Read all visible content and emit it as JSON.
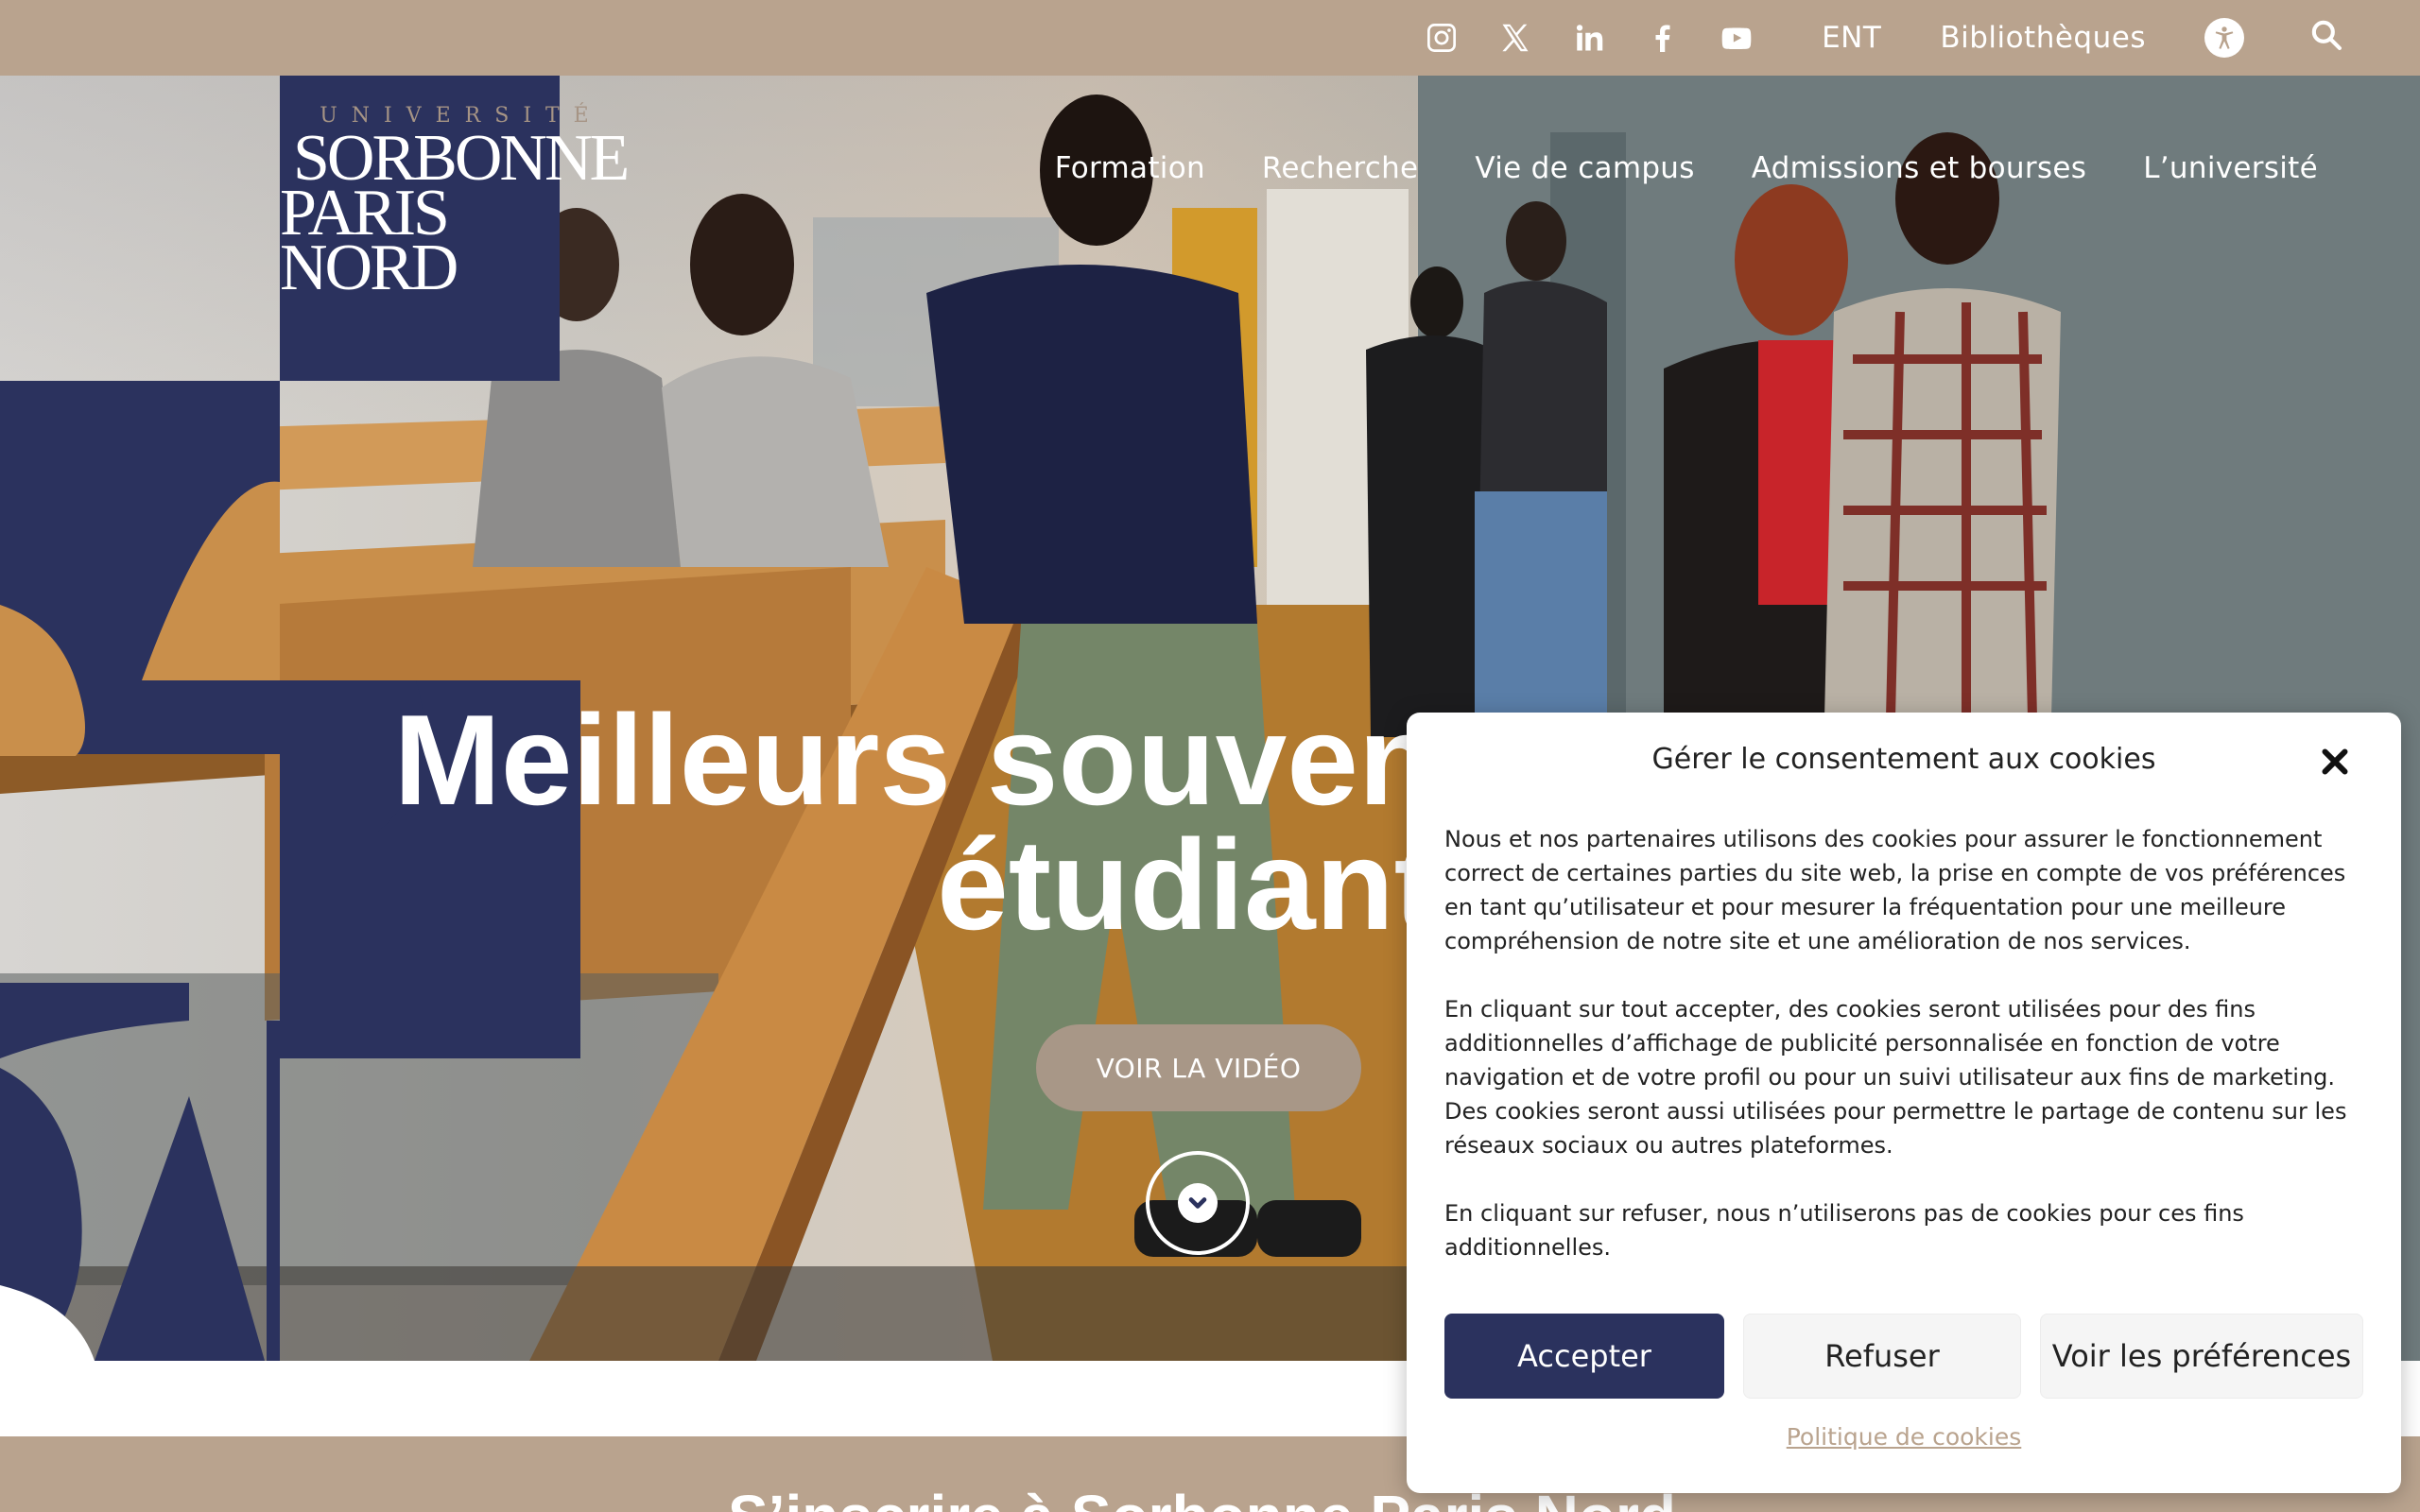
{
  "colors": {
    "brand_beige": "#b9a38e",
    "brand_navy": "#2b325e",
    "video_button": "#a89787",
    "white": "#ffffff"
  },
  "topbar": {
    "social_icons": [
      "instagram-icon",
      "x-icon",
      "linkedin-icon",
      "facebook-icon",
      "youtube-icon"
    ],
    "ent_label": "ENT",
    "libraries_label": "Bibliothèques",
    "accessibility_icon": "accessibility-icon",
    "search_icon": "search-icon"
  },
  "logo": {
    "line_top": "UNIVERSITÉ",
    "line1": "SORBONNE",
    "line2": "PARIS NORD"
  },
  "nav": {
    "items": [
      "Formation",
      "Recherche",
      "Vie de campus",
      "Admissions et bourses",
      "L’université"
    ]
  },
  "hero": {
    "title_line1": "Meilleurs souven",
    "title_line2": "étudiant",
    "video_button": "VOIR LA VIDÉO",
    "scroll_icon": "chevron-down-icon"
  },
  "next_section": {
    "heading": "S’inscrire à Sorbonne Paris Nord"
  },
  "cookie_modal": {
    "title": "Gérer le consentement aux cookies",
    "close_icon": "close-icon",
    "paragraphs": [
      "Nous et nos partenaires utilisons des cookies pour assurer le fonctionnement correct de certaines parties du site web, la prise en compte de vos préférences en tant qu’utilisateur et pour mesurer la fréquentation pour une meilleure compréhension de notre site et une amélioration de nos services.",
      "En cliquant sur tout accepter, des cookies seront utilisées pour des fins additionnelles d’affichage de publicité personnalisée en fonction de votre navigation et de votre profil ou pour un suivi utilisateur aux fins de marketing. Des cookies seront aussi utilisées pour permettre le partage de contenu sur les réseaux sociaux ou autres plateformes.",
      "En cliquant sur refuser, nous n’utiliserons pas de cookies pour ces fins additionnelles."
    ],
    "accept_label": "Accepter",
    "refuse_label": "Refuser",
    "preferences_label": "Voir les préférences",
    "policy_link": "Politique de cookies"
  }
}
